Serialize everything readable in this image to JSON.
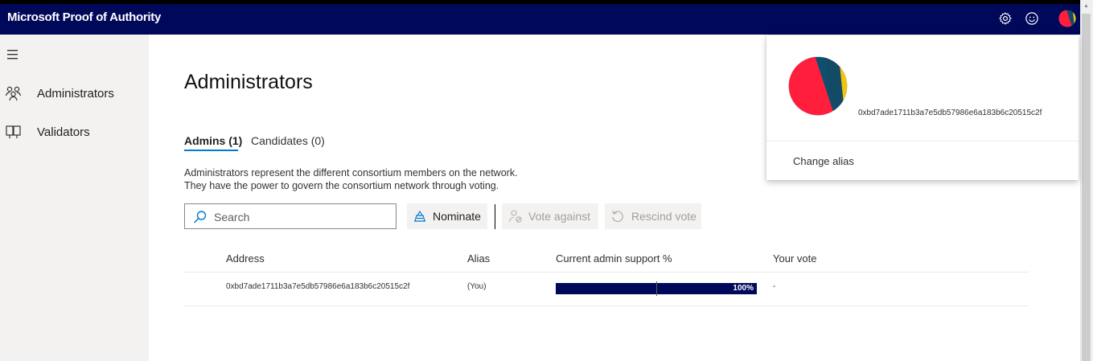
{
  "header": {
    "app_title": "Microsoft Proof of Authority",
    "icons": [
      "gear-icon",
      "smiley-icon",
      "avatar"
    ]
  },
  "sidebar": {
    "menu_icon": "hamburger-icon",
    "items": [
      {
        "label": "Administrators",
        "icon": "people-icon"
      },
      {
        "label": "Validators",
        "icon": "validators-icon"
      }
    ]
  },
  "main": {
    "title": "Administrators",
    "tabs": [
      {
        "label": "Admins (1)",
        "active": true
      },
      {
        "label": "Candidates (0)",
        "active": false
      }
    ],
    "description": [
      "Administrators represent the different consortium members on the network.",
      "They have the power to govern the consortium network through voting."
    ],
    "search": {
      "placeholder": "Search"
    },
    "commands": [
      {
        "label": "Nominate",
        "enabled": true,
        "icon": "nominate-icon"
      },
      {
        "label": "Vote against",
        "enabled": false,
        "icon": "vote-against-icon"
      },
      {
        "label": "Rescind vote",
        "enabled": false,
        "icon": "rescind-icon"
      }
    ],
    "table": {
      "columns": [
        "Address",
        "Alias",
        "Current admin support %",
        "Your vote"
      ],
      "rows": [
        {
          "address": "0xbd7ade1711b3a7e5db57986e6a183b6c20515c2f",
          "alias": "(You)",
          "support": 1.0,
          "support_label": "100%",
          "vote": "-"
        }
      ]
    }
  },
  "profile_panel": {
    "address": "0xbd7ade1711b3a7e5db57986e6a183b6c20515c2f",
    "change_alias_label": "Change alias"
  },
  "colors": {
    "topbar": "#00085a",
    "accent": "#0078d4",
    "sidebar_bg": "#f3f2f1",
    "progress_fill": "#00085a"
  }
}
